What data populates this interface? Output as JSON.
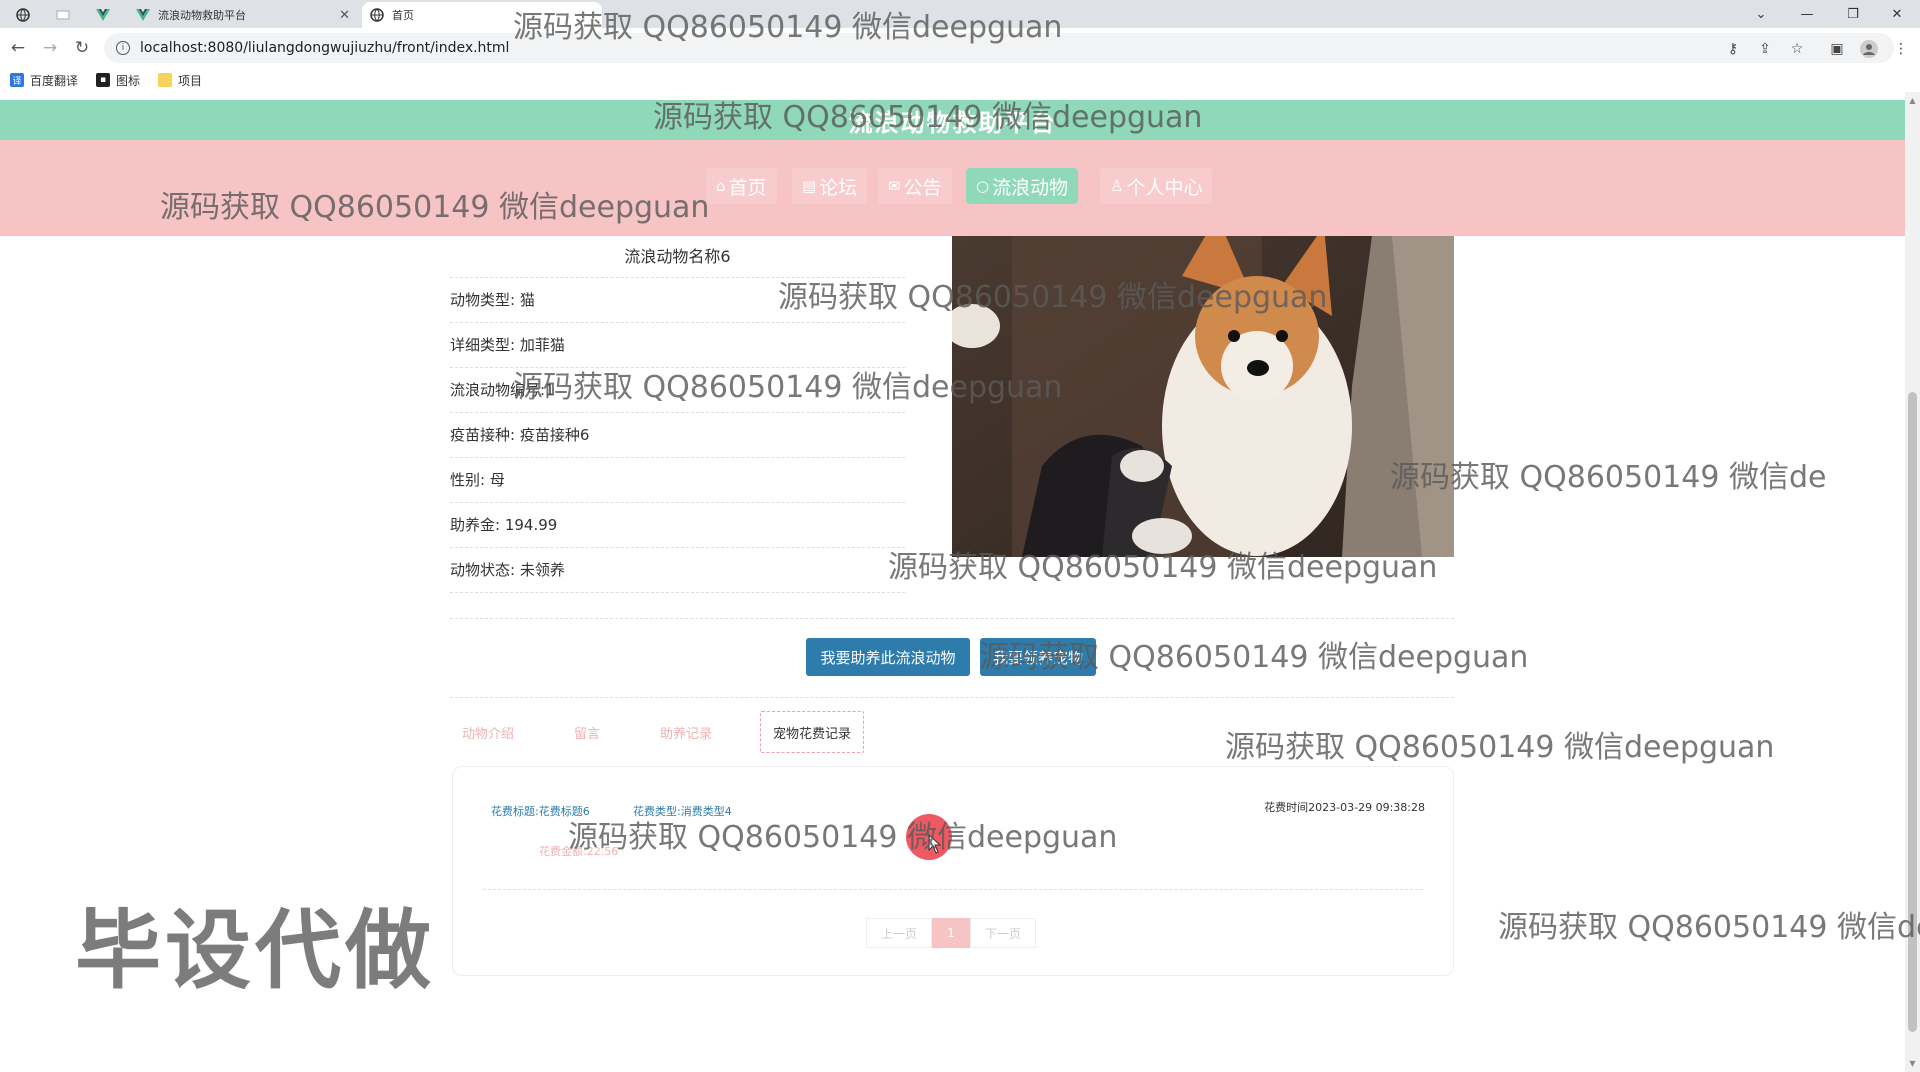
{
  "browser": {
    "tabs": [
      {
        "label": "",
        "icon": "globe-icon"
      },
      {
        "label": "",
        "icon": "blank-page-icon"
      },
      {
        "label": "",
        "icon": "vue-logo-icon"
      },
      {
        "label": "流浪动物救助平台",
        "icon": "vue-logo-icon"
      },
      {
        "label": "首页",
        "icon": "globe-icon",
        "active": true
      }
    ],
    "url": "localhost:8080/liulangdongwujiuzhu/front/index.html",
    "bookmarks": [
      {
        "label": "百度翻译",
        "icon": "translate-icon"
      },
      {
        "label": "图标",
        "icon": "image-icon"
      },
      {
        "label": "项目",
        "icon": "folder-icon"
      }
    ]
  },
  "site": {
    "title": "流浪动物救助平台",
    "nav": [
      {
        "label": "首页",
        "icon": "home-icon"
      },
      {
        "label": "论坛",
        "icon": "forum-icon"
      },
      {
        "label": "公告",
        "icon": "mail-icon"
      },
      {
        "label": "流浪动物",
        "icon": "circle-icon",
        "active": true
      },
      {
        "label": "个人中心",
        "icon": "user-icon"
      }
    ]
  },
  "animal": {
    "name": "流浪动物名称6",
    "type_label": "动物类型: 猫",
    "breed_label": "详细类型: 加菲猫",
    "number_label": "流浪动物编号:1",
    "vaccine_label": "疫苗接种: 疫苗接种6",
    "gender_label": "性别: 母",
    "fund_label": "助养金: 194.99",
    "status_label": "动物状态: 未领养",
    "photo_alt": "dog-photo"
  },
  "actions": {
    "sponsor": "我要助养此流浪动物",
    "adopt": "我要领养宠物"
  },
  "detail_tabs": [
    {
      "label": "动物介绍"
    },
    {
      "label": "留言"
    },
    {
      "label": "助养记录"
    },
    {
      "label": "宠物花费记录",
      "active": true
    }
  ],
  "record": {
    "title": "花费标题:花费标题6",
    "type": "花费类型:消费类型4",
    "time": "花费时间2023-03-29 09:38:28",
    "amount": "花费金额:22.56"
  },
  "pager": {
    "prev": "上一页",
    "current": "1",
    "next": "下一页"
  },
  "watermarks": {
    "qq": "源码获取 QQ86050149 微信deepguan",
    "qq_cut": "源码获取 QQ86050149 微信de",
    "bishe": "毕设代做"
  },
  "colors": {
    "title_bar": "#8fd8b9",
    "nav_bar": "#f7c4c6",
    "button": "#2d7cab",
    "cursor_highlight": "#eb3c46"
  }
}
